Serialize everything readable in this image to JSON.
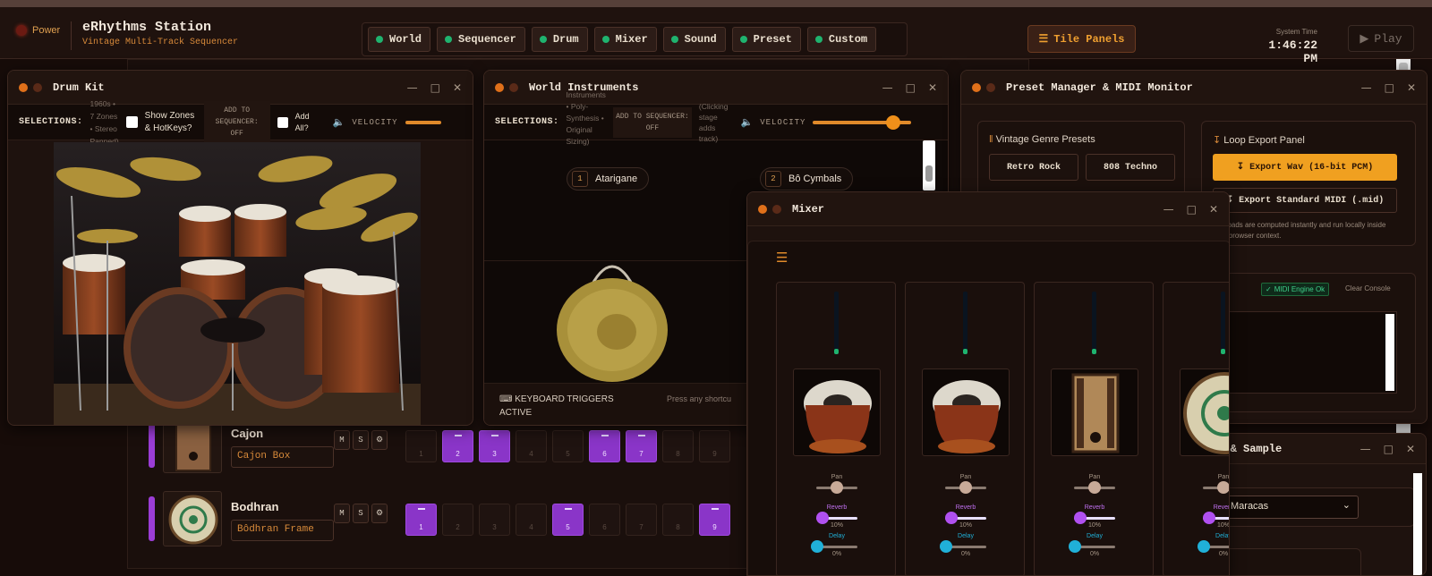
{
  "header": {
    "power_label": "Power",
    "app_title": "eRhythms Station",
    "app_subtitle": "Vintage Multi-Track Sequencer",
    "tabs": [
      "World",
      "Sequencer",
      "Drum",
      "Mixer",
      "Sound",
      "Preset",
      "Custom"
    ],
    "tile_label": "Tile Panels",
    "system_time_label": "System Time",
    "system_time": "1:46:22 PM",
    "play_label": "Play"
  },
  "sequencer": {
    "tracks": [
      {
        "name": "Cajon",
        "sound": "Cajon Box",
        "active_steps": [
          2,
          3,
          6,
          7
        ]
      },
      {
        "name": "Bodhran",
        "sound": "Bôdhran Frame",
        "active_steps": [
          1,
          5,
          9
        ]
      }
    ],
    "mute_label": "M",
    "solo_label": "S",
    "step_numbers": [
      "1",
      "2",
      "3",
      "4",
      "5",
      "6",
      "7",
      "8",
      "9"
    ]
  },
  "drum_kit": {
    "title": "Drum Kit",
    "selections_label": "SELECTIONS:",
    "info_lines": [
      "1960s •",
      "7 Zones",
      "• Stereo",
      "Panned)"
    ],
    "show_zones_label": "Show Zones & HotKeys?",
    "add_to_seq_label": "ADD TO SEQUENCER:",
    "add_to_seq_state": "OFF",
    "add_all_label": "Add All?",
    "velocity_label": "VELOCITY"
  },
  "world_instruments": {
    "title": "World Instruments",
    "selections_label": "SELECTIONS:",
    "info_lines": [
      "Instruments",
      "• Poly-",
      "Synthesis •",
      "Original",
      "Sizing)"
    ],
    "add_to_seq_label": "ADD TO SEQUENCER:",
    "add_to_seq_state": "OFF",
    "hint_lines": [
      "(Clicking",
      "stage",
      "adds",
      "track)"
    ],
    "velocity_label": "VELOCITY",
    "velocity_value": 0.8,
    "instruments": [
      {
        "num": "1",
        "name": "Atarigane"
      },
      {
        "num": "2",
        "name": "Bô Cymbals"
      }
    ],
    "keyboard_label": "KEYBOARD TRIGGERS",
    "keyboard_state": "ACTIVE",
    "keyboard_hint": "Press any shortcu"
  },
  "preset_manager": {
    "title": "Preset Manager & MIDI Monitor",
    "genre_title": "Vintage Genre Presets",
    "genre_buttons": [
      "Retro Rock",
      "808 Techno"
    ],
    "export_title": "Loop Export Panel",
    "export_wav": "Export Wav (16-bit PCM)",
    "export_midi": "Export Standard MIDI (.mid)",
    "export_note": "ownloads are computed instantly and run locally inside your browser context.",
    "midi_status": "MIDI Engine Ok",
    "clear_label": "Clear Console"
  },
  "mixer": {
    "title": "Mixer",
    "pan_label": "Pan",
    "reverb_label": "Reverb",
    "delay_label": "Delay",
    "reverb_value": "10%",
    "delay_value": "0%",
    "channels": [
      {
        "instrument": "tabla"
      },
      {
        "instrument": "tabla"
      },
      {
        "instrument": "cajon"
      },
      {
        "instrument": "bodhran"
      }
    ]
  },
  "sampler": {
    "title": "er & Sample",
    "select_prefix": "h:",
    "select_value": "Maracas"
  },
  "colors": {
    "accent_orange": "#f0a020",
    "step_active": "#8a35c8",
    "led_green": "#1fb36f",
    "reverb": "#b050f0",
    "delay": "#20b0d8"
  }
}
